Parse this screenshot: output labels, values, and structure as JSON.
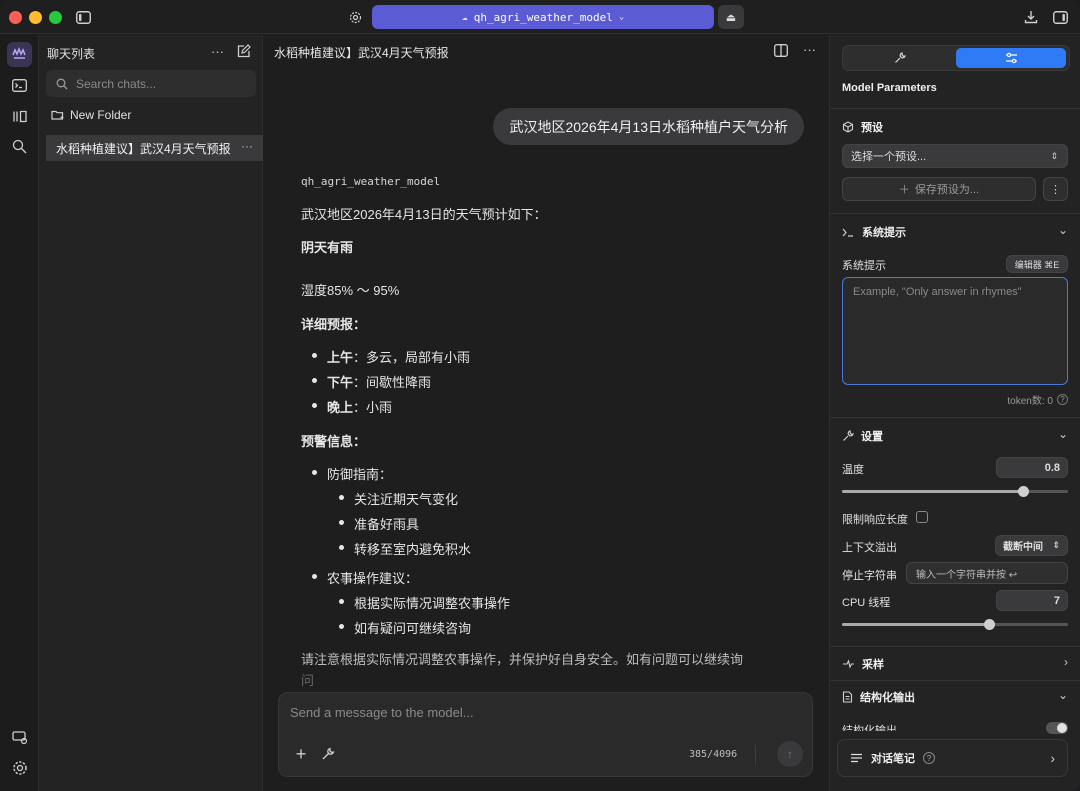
{
  "titlebar": {
    "model": "qh_agri_weather_model"
  },
  "chatlist": {
    "title": "聊天列表",
    "search_placeholder": "Search chats...",
    "new_folder": "New Folder",
    "items": [
      {
        "label": "水稻种植建议】武汉4月天气预报"
      }
    ]
  },
  "main": {
    "title": "水稻种植建议】武汉4月天气预报",
    "user_message": "武汉地区2026年4月13日水稻种植户天气分析",
    "reply": {
      "model": "qh_agri_weather_model",
      "intro": "武汉地区2026年4月13日的天气预计如下：",
      "condition": "阴天有雨",
      "humidity": "湿度85% ～ 95%",
      "detail_heading": "详细预报：",
      "detail": [
        {
          "k": "上午",
          "v": "：多云，局部有小雨"
        },
        {
          "k": "下午",
          "v": "：间歇性降雨"
        },
        {
          "k": "晚上",
          "v": "：小雨"
        }
      ],
      "warning_heading": "预警信息：",
      "defense_label": "防御指南：",
      "defense": [
        "关注近期天气变化",
        "准备好雨具",
        "转移至室内避免积水"
      ],
      "farm_label": "农事操作建议：",
      "farm": [
        "根据实际情况调整农事操作",
        "如有疑问可继续咨询"
      ],
      "closing_1": "请注意根据实际情况调整农事操作，并保护好自身安全。如有问题可以继续询",
      "closing_2": "问"
    },
    "composer": {
      "placeholder": "Send a message to the model...",
      "counter": "385/4096"
    }
  },
  "panel": {
    "title": "Model Parameters",
    "preset": {
      "heading": "预设",
      "select": "选择一个预设...",
      "save": "保存预设为..."
    },
    "system": {
      "heading": "系统提示",
      "label": "系统提示",
      "editor_badge": "编辑器 ⌘E",
      "placeholder": "Example, \"Only answer in rhymes\"",
      "tokens": "token数: 0"
    },
    "settings": {
      "heading": "设置",
      "temperature_label": "温度",
      "temperature": "0.8",
      "temperature_fraction": 0.8,
      "limit_label": "限制响应长度",
      "overflow_label": "上下文溢出",
      "overflow_value": "截断中间",
      "stop_label": "停止字符串",
      "stop_placeholder": "输入一个字符串并按 ↩",
      "cpu_label": "CPU 线程",
      "cpu": "7",
      "cpu_fraction": 0.65
    },
    "sampling": {
      "heading": "采样"
    },
    "structured": {
      "heading": "结构化输出",
      "label": "结构化输出"
    },
    "notes": {
      "label": "对话笔记"
    }
  },
  "colors": {
    "accent": "#5b5bd6",
    "active_tab": "#2f7bf5",
    "focus": "#4a79d6"
  }
}
